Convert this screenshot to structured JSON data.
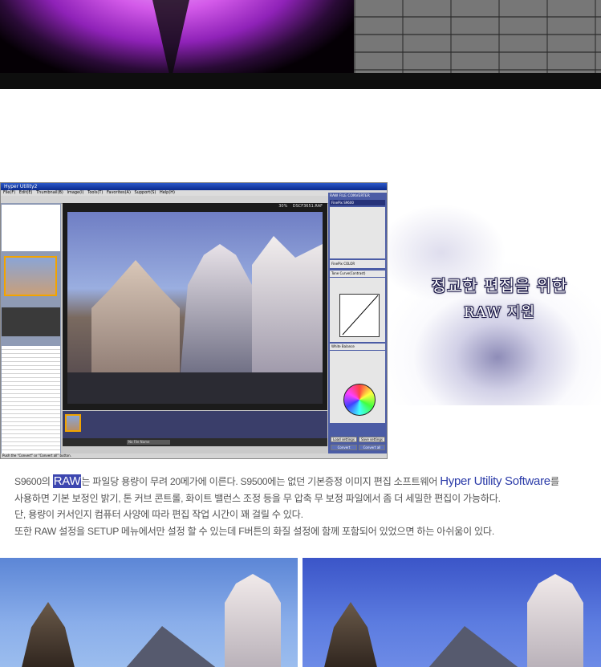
{
  "app": {
    "title": "Hyper Utility2",
    "menu": [
      "File(F)",
      "Edit(E)",
      "Thumbnail(B)",
      "Image(I)",
      "Tools(T)",
      "Favorites(A)",
      "Support(S)",
      "Help(H)"
    ],
    "zoom": "30%",
    "filename": "DSCF3651.RAF",
    "right_panel_title": "RAW FILE CONVERTER",
    "right_panel_logo": "FinePix S9600",
    "sections": {
      "tone_curve": "Tone Curve(Contrast)",
      "white_balance": "White Balance",
      "finepix_color": "FinePix COLOR"
    },
    "buttons": {
      "load_settings": "Load settings",
      "save_settings": "Save settings",
      "convert": "Convert",
      "convert_all": "Convert all"
    },
    "view_select": "No File Name",
    "status": "Push the \"Convert\" or \"Convert all\" button."
  },
  "headline": {
    "line1": "정교한 편집을 위한",
    "line2": "RAW 지원"
  },
  "paragraph": {
    "l1_a": "S9600의 ",
    "l1_hl": "RAW",
    "l1_b": "는 파일당 용량이 무려 20메가에 이른다. S9500에는 없던 기본증정 이미지 편집 소프트웨어 ",
    "l1_blue": "Hyper Utility Software",
    "l1_c": "를",
    "l2": "사용하면 기본 보정인 밝기, 톤 커브 콘트롤, 화이트 밸런스 조정 등을 무 압축 무 보정 파일에서 좀 더 세밀한 편집이 가능하다.",
    "l3": "단, 용량이 커서인지 컴퓨터 사양에 따라 편집 작업 시간이 꽤 걸릴 수 있다.",
    "l4": "또한 RAW 설정을 SETUP 메뉴에서만 설정 할 수 있는데 F버튼의 화질 설정에 함께 포함되어 있었으면 하는 아쉬움이 있다."
  }
}
